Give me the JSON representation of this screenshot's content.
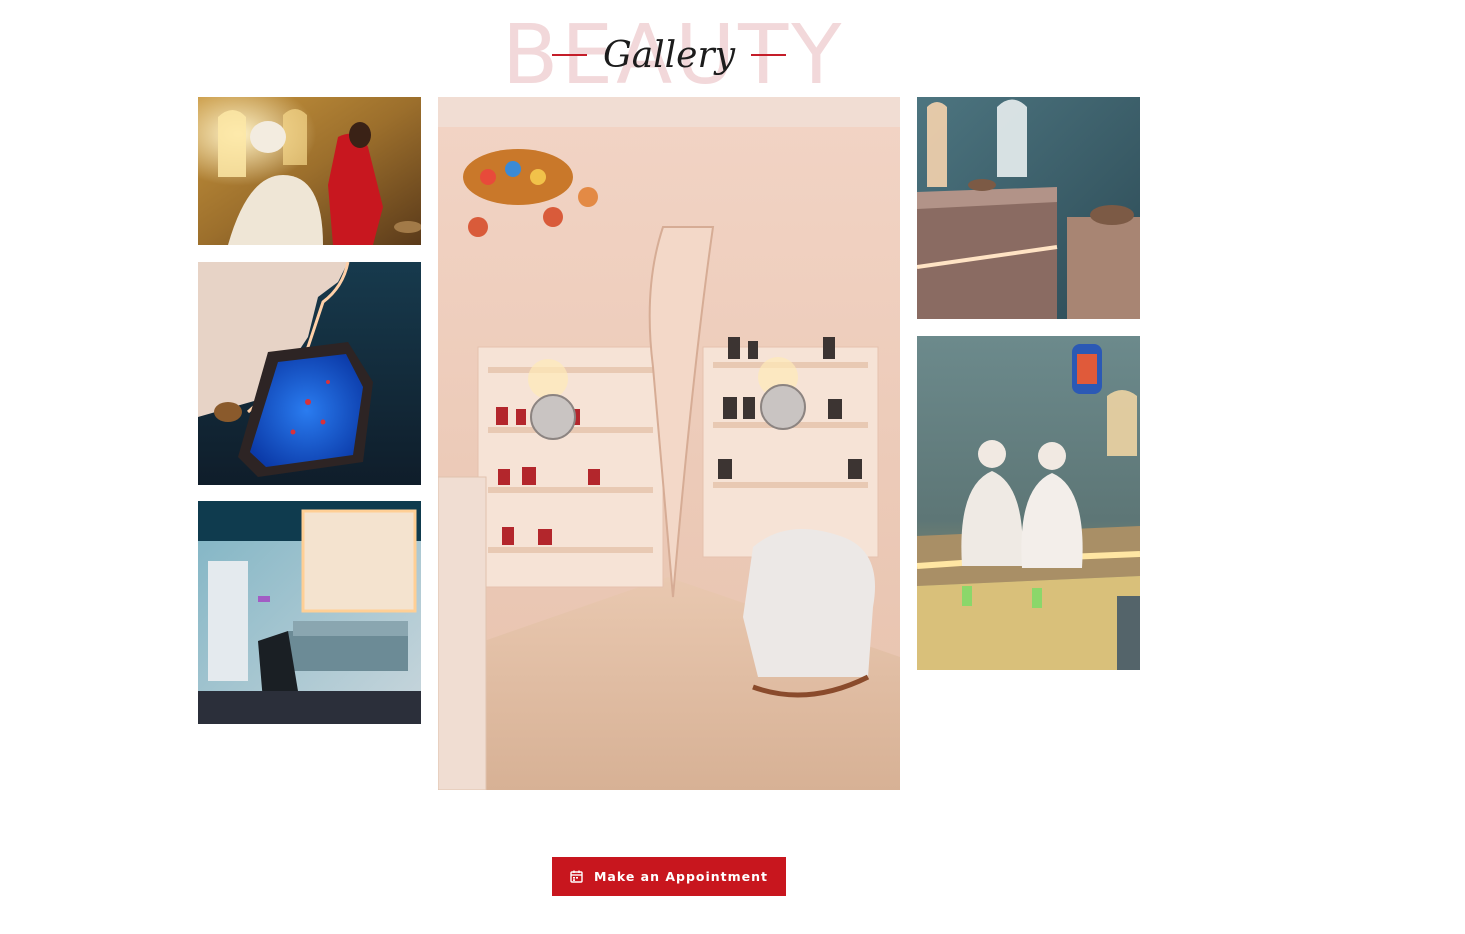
{
  "section": {
    "background_word": "BEAUTY",
    "title": "Gallery",
    "accent_color": "#c41d29"
  },
  "gallery": {
    "images": [
      {
        "icon": "photo-facial-treatment"
      },
      {
        "icon": "photo-hammam-pool"
      },
      {
        "icon": "photo-treatment-room"
      },
      {
        "icon": "photo-product-boutique"
      },
      {
        "icon": "photo-marble-hammam"
      },
      {
        "icon": "photo-steam-bath-guests"
      }
    ]
  },
  "cta": {
    "label": "Make an Appointment",
    "icon": "calendar-icon",
    "color": "#c8161e"
  }
}
